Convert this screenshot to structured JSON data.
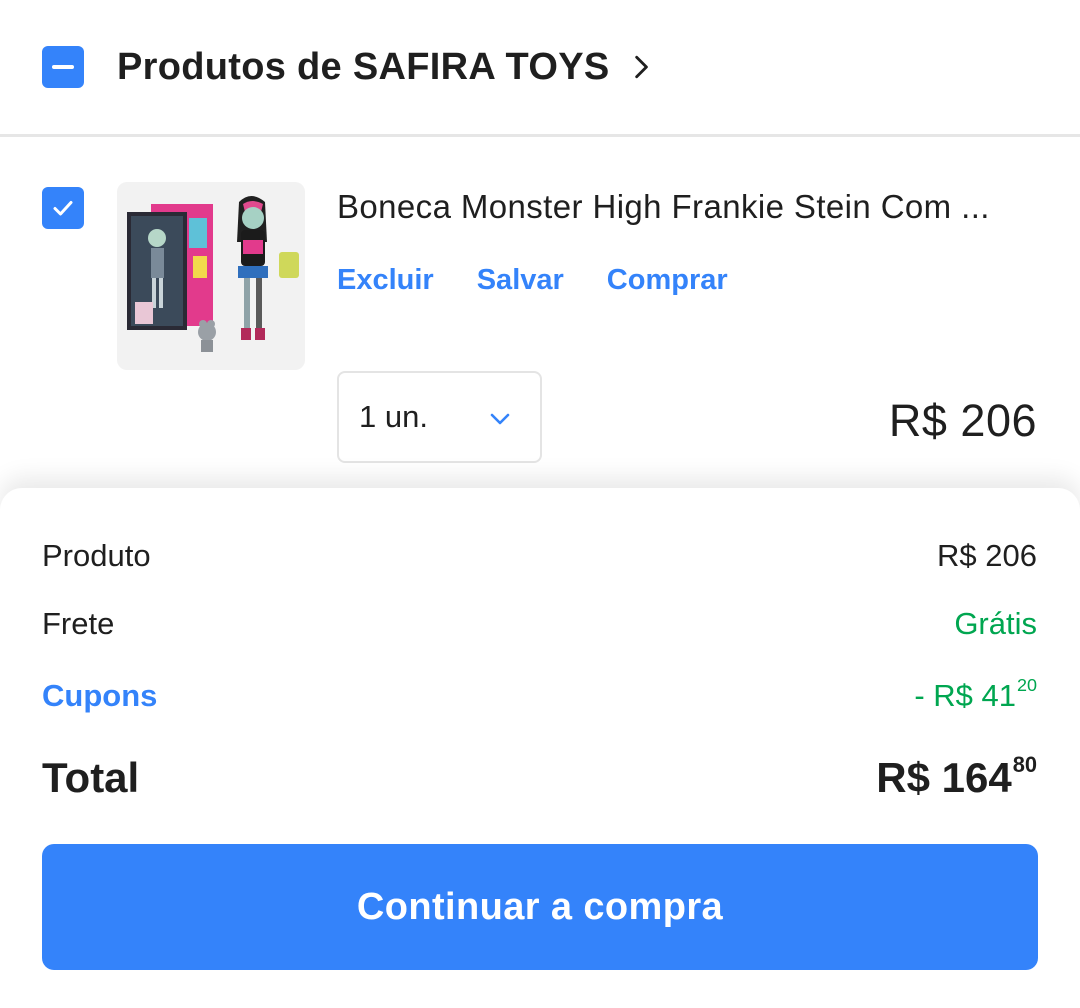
{
  "colors": {
    "accent": "#3483fa",
    "success": "#00a650",
    "text": "#1f1f1f",
    "divider": "#e6e6e6"
  },
  "seller": {
    "checkbox_state": "indeterminate",
    "title": "Produtos de SAFIRA TOYS",
    "chevron_icon": "chevron-right-icon"
  },
  "item": {
    "checkbox_state": "checked",
    "title": "Boneca Monster High Frankie Stein Com ...",
    "image_icon": "product-photo",
    "actions": {
      "delete": "Excluir",
      "save": "Salvar",
      "buy": "Comprar"
    },
    "quantity": "1 un.",
    "price": "R$ 206"
  },
  "summary": {
    "product_label": "Produto",
    "product_value": "R$ 206",
    "shipping_label": "Frete",
    "shipping_value": "Grátis",
    "coupons_label": "Cupons",
    "coupons_value_main": "- R$ 41",
    "coupons_value_cents": "20",
    "total_label": "Total",
    "total_value_main": "R$ 164",
    "total_value_cents": "80"
  },
  "cta": {
    "label": "Continuar a compra"
  }
}
